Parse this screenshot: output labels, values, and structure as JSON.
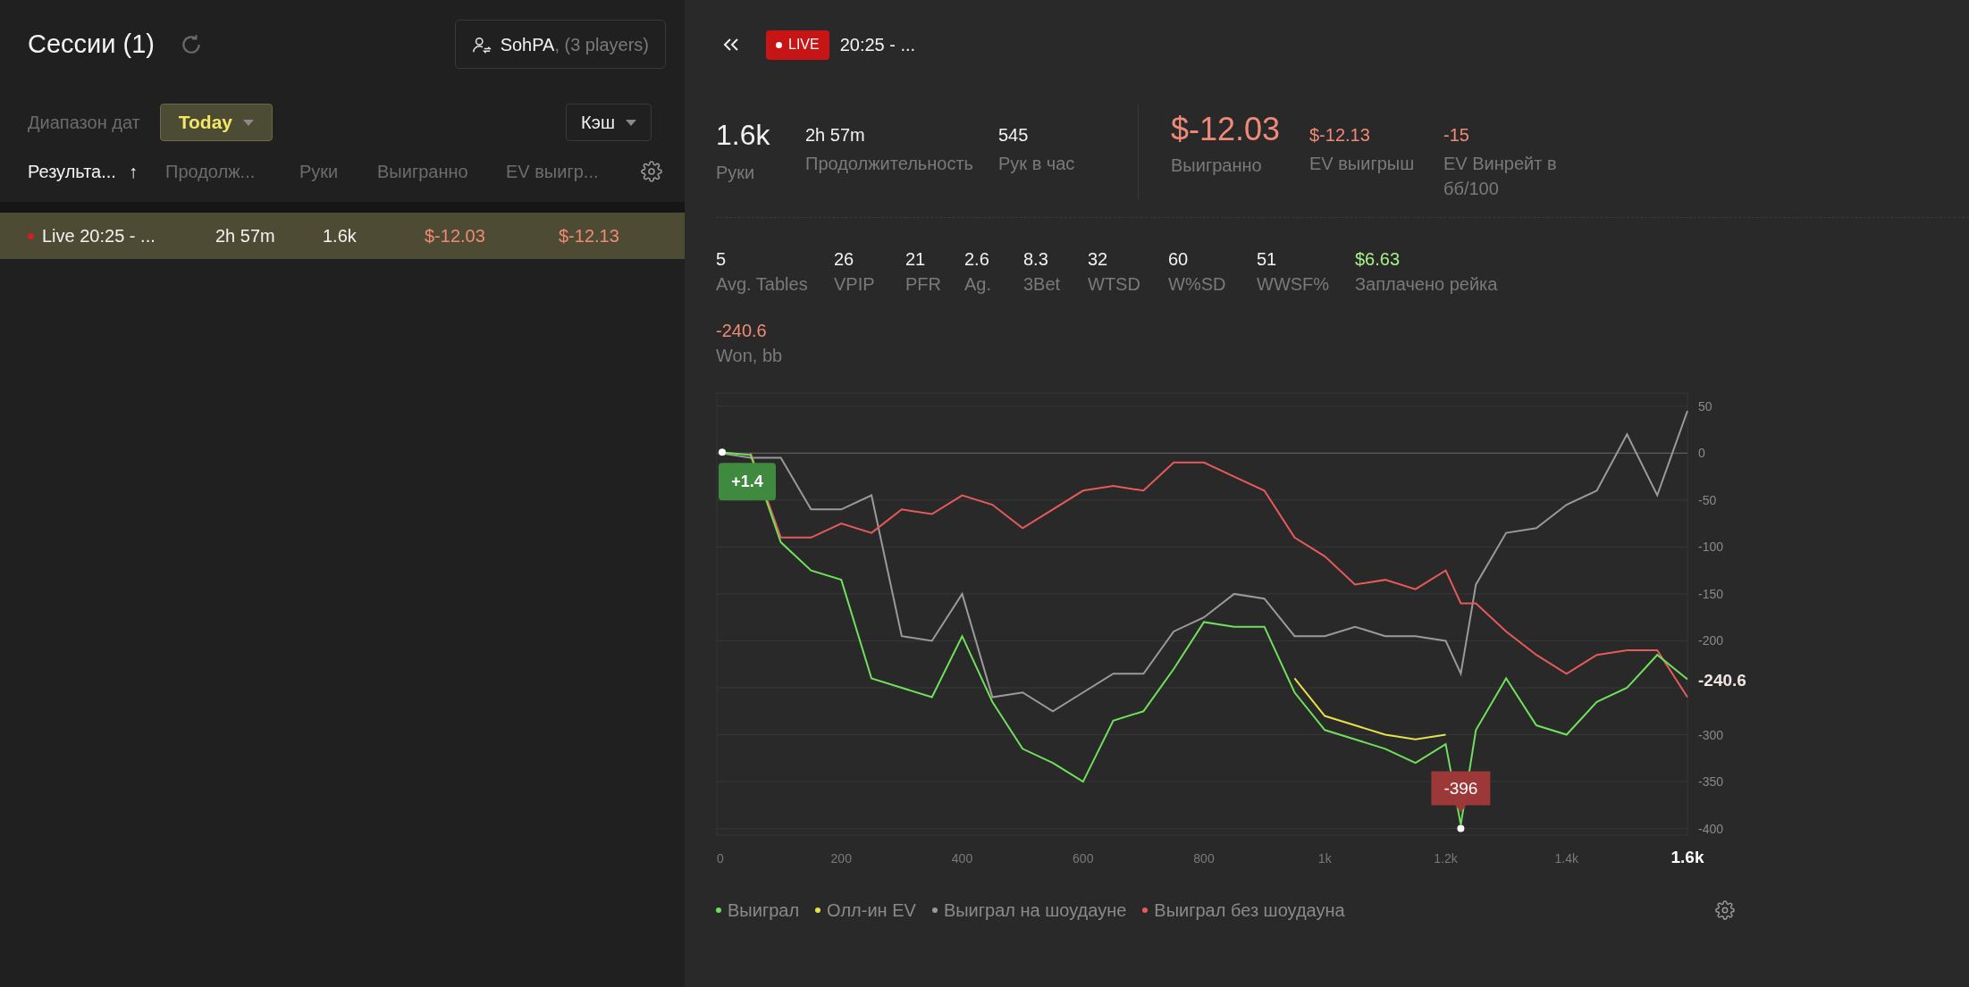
{
  "sessions_panel": {
    "title": "Сессии (1)",
    "player_button": {
      "name": "SohPA",
      "suffix": ", (3 players)"
    },
    "date_range": {
      "label": "Диапазон дат",
      "value": "Today"
    },
    "game_type": {
      "value": "Кэш"
    },
    "columns": [
      {
        "label": "Результа...",
        "selected": true,
        "sort": "↑"
      },
      {
        "label": "Продолж...",
        "selected": false
      },
      {
        "label": "Руки",
        "selected": false
      },
      {
        "label": "Выигранно",
        "selected": false
      },
      {
        "label": "EV выигр...",
        "selected": false
      }
    ],
    "rows": [
      {
        "selected": true,
        "live": true,
        "cells": [
          {
            "text": "Live 20:25 - ...",
            "color": "#f2f2f2"
          },
          {
            "text": "2h 57m",
            "color": "#f2f2f2"
          },
          {
            "text": "1.6k",
            "color": "#f2f2f2"
          },
          {
            "text": "$-12.03",
            "color": "#f08a78"
          },
          {
            "text": "$-12.13",
            "color": "#f08a78"
          }
        ]
      }
    ]
  },
  "session_detail": {
    "badge": "LIVE",
    "title": "20:25 - ...",
    "summary_left": [
      {
        "value": "1.6k",
        "label": "Руки",
        "kind": "large",
        "color": "#f2f2f2"
      },
      {
        "value": "2h 57m",
        "label": "Продолжительность",
        "kind": "small",
        "color": "#f2f2f2"
      },
      {
        "value": "545",
        "label": "Рук в час",
        "kind": "small",
        "color": "#f2f2f2"
      }
    ],
    "summary_right": [
      {
        "value": "$-12.03",
        "label": "Выигранно",
        "kind": "large",
        "color": "#f08a78"
      },
      {
        "value": "$-12.13",
        "label": "EV выигрыш",
        "kind": "small",
        "color": "#f08a78"
      },
      {
        "value": "-15",
        "label": "EV Винрейт в бб/100",
        "kind": "small",
        "color": "#f08a78"
      }
    ],
    "stats": [
      {
        "value": "5",
        "label": "Avg. Tables",
        "color": "#f2f2f2"
      },
      {
        "value": "26",
        "label": "VPIP",
        "color": "#f2f2f2"
      },
      {
        "value": "21",
        "label": "PFR",
        "color": "#f2f2f2"
      },
      {
        "value": "2.6",
        "label": "Ag.",
        "color": "#f2f2f2"
      },
      {
        "value": "8.3",
        "label": "3Bet",
        "color": "#f2f2f2"
      },
      {
        "value": "32",
        "label": "WTSD",
        "color": "#f2f2f2"
      },
      {
        "value": "60",
        "label": "W%SD",
        "color": "#f2f2f2"
      },
      {
        "value": "51",
        "label": "WWSF%",
        "color": "#f2f2f2"
      },
      {
        "value": "$6.63",
        "label": "Заплачено рейка",
        "color": "#a8f08a"
      }
    ],
    "won_bb": {
      "value": "-240.6",
      "label": "Won, bb",
      "color": "#f08a78"
    },
    "chart_data": {
      "type": "line",
      "grid": true,
      "x": [
        0,
        50,
        100,
        150,
        200,
        250,
        300,
        350,
        400,
        450,
        500,
        550,
        600,
        650,
        700,
        750,
        800,
        850,
        900,
        950,
        1000,
        1050,
        1100,
        1150,
        1200,
        1225,
        1250,
        1300,
        1350,
        1400,
        1450,
        1500,
        1550,
        1600
      ],
      "xlim": [
        0,
        1600
      ],
      "ylim": [
        -407,
        64
      ],
      "xticks": [
        0,
        200,
        400,
        600,
        800,
        {
          "value": 1000,
          "label": "1k"
        },
        {
          "value": 1200,
          "label": "1.2k"
        },
        {
          "value": 1400,
          "label": "1.4k"
        },
        {
          "value": 1600,
          "label": "1.6k"
        }
      ],
      "yticks": [
        50,
        0,
        -50,
        -100,
        -150,
        -200,
        -300,
        -350,
        -400
      ],
      "series": [
        {
          "name": "Выиграл",
          "color": "#6fe05c",
          "values": [
            1,
            -2,
            -95,
            -125,
            -135,
            -240,
            -250,
            -260,
            -195,
            -265,
            -315,
            -330,
            -350,
            -285,
            -275,
            -230,
            -180,
            -185,
            -185,
            -255,
            -295,
            -305,
            -315,
            -330,
            -310,
            -396,
            -295,
            -240,
            -290,
            -300,
            -265,
            -250,
            -215,
            -241
          ]
        },
        {
          "name": "Олл-ин EV",
          "color": "#e8e04a",
          "values": [
            null,
            null,
            null,
            null,
            null,
            null,
            null,
            null,
            null,
            null,
            null,
            null,
            null,
            null,
            null,
            null,
            null,
            null,
            null,
            -240,
            -280,
            -290,
            -300,
            -305,
            -300,
            null,
            null,
            null,
            null,
            null,
            null,
            null,
            null,
            null
          ]
        },
        {
          "name": "Выиграл на шоудауне",
          "color": "#9a9a9a",
          "values": [
            0,
            -5,
            -5,
            -60,
            -60,
            -45,
            -195,
            -200,
            -150,
            -260,
            -255,
            -275,
            -255,
            -235,
            -235,
            -190,
            -175,
            -150,
            -155,
            -195,
            -195,
            -185,
            -195,
            -195,
            -200,
            -235,
            -140,
            -85,
            -80,
            -55,
            -40,
            20,
            -45,
            45
          ]
        },
        {
          "name": "Выиграл без шоудауна",
          "color": "#e85a5a",
          "values": [
            null,
            0,
            -90,
            -90,
            -75,
            -85,
            -60,
            -65,
            -45,
            -55,
            -80,
            -60,
            -40,
            -35,
            -40,
            -10,
            -10,
            -25,
            -40,
            -90,
            -110,
            -140,
            -135,
            -145,
            -125,
            -160,
            -160,
            -190,
            -215,
            -235,
            -215,
            -210,
            -210,
            -260
          ]
        }
      ],
      "annotations": [
        {
          "x": 0,
          "y": 1,
          "text": "+1.4"
        },
        {
          "x": 1225,
          "y": -396,
          "text": "-396"
        },
        {
          "x": 1600,
          "y": -241,
          "text": "-240.6"
        }
      ]
    }
  }
}
